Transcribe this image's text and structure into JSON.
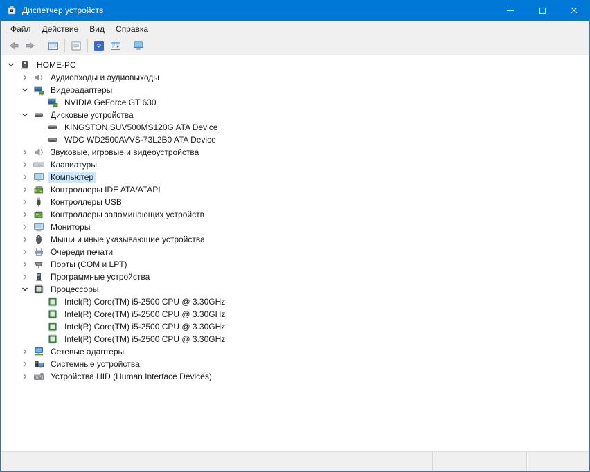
{
  "colors": {
    "accent": "#0078D7",
    "selection": "#CCE8FF",
    "window_border": "#4E6F8A"
  },
  "window": {
    "title": "Диспетчер устройств",
    "app_icon": "device-manager-icon",
    "controls": [
      {
        "name": "minimize",
        "icon": "minimize-icon"
      },
      {
        "name": "maximize",
        "icon": "maximize-icon"
      },
      {
        "name": "close",
        "icon": "close-icon"
      }
    ]
  },
  "menu": {
    "items": [
      {
        "label": "Файл",
        "hotkey": "Ф"
      },
      {
        "label": "Действие",
        "hotkey": "Д"
      },
      {
        "label": "Вид",
        "hotkey": "В"
      },
      {
        "label": "Справка",
        "hotkey": "С"
      }
    ]
  },
  "toolbar": {
    "items": [
      {
        "type": "button",
        "name": "back",
        "icon": "back-arrow-icon"
      },
      {
        "type": "button",
        "name": "forward",
        "icon": "forward-arrow-icon"
      },
      {
        "type": "separator"
      },
      {
        "type": "button",
        "name": "show-console-tree",
        "icon": "console-tree-icon"
      },
      {
        "type": "separator"
      },
      {
        "type": "button",
        "name": "properties",
        "icon": "properties-icon"
      },
      {
        "type": "separator"
      },
      {
        "type": "button",
        "name": "help",
        "icon": "help-icon"
      },
      {
        "type": "button",
        "name": "show-action-pane",
        "icon": "action-pane-icon"
      },
      {
        "type": "separator"
      },
      {
        "type": "button",
        "name": "scan-hardware-changes",
        "icon": "scan-hardware-icon"
      }
    ]
  },
  "tree": {
    "rows": [
      {
        "level": 0,
        "state": "expanded",
        "icon": "computer-icon",
        "label": "HOME-PC",
        "selected": false
      },
      {
        "level": 1,
        "state": "collapsed",
        "icon": "audio-device-icon",
        "label": "Аудиовходы и аудиовыходы",
        "selected": false
      },
      {
        "level": 1,
        "state": "expanded",
        "icon": "display-adapter-icon",
        "label": "Видеоадаптеры",
        "selected": false
      },
      {
        "level": 2,
        "state": "leaf",
        "icon": "display-adapter-icon",
        "label": "NVIDIA GeForce GT 630",
        "selected": false
      },
      {
        "level": 1,
        "state": "expanded",
        "icon": "disk-drive-icon",
        "label": "Дисковые устройства",
        "selected": false
      },
      {
        "level": 2,
        "state": "leaf",
        "icon": "disk-drive-icon",
        "label": "KINGSTON SUV500MS120G ATA Device",
        "selected": false
      },
      {
        "level": 2,
        "state": "leaf",
        "icon": "disk-drive-icon",
        "label": "WDC WD2500AVVS-73L2B0 ATA Device",
        "selected": false
      },
      {
        "level": 1,
        "state": "collapsed",
        "icon": "sound-device-icon",
        "label": "Звуковые, игровые и видеоустройства",
        "selected": false
      },
      {
        "level": 1,
        "state": "collapsed",
        "icon": "keyboard-icon",
        "label": "Клавиатуры",
        "selected": false
      },
      {
        "level": 1,
        "state": "collapsed",
        "icon": "monitor-icon",
        "label": "Компьютер",
        "selected": true
      },
      {
        "level": 1,
        "state": "collapsed",
        "icon": "ide-controller-icon",
        "label": "Контроллеры IDE ATA/ATAPI",
        "selected": false
      },
      {
        "level": 1,
        "state": "collapsed",
        "icon": "usb-controller-icon",
        "label": "Контроллеры USB",
        "selected": false
      },
      {
        "level": 1,
        "state": "collapsed",
        "icon": "storage-controller-icon",
        "label": "Контроллеры запоминающих устройств",
        "selected": false
      },
      {
        "level": 1,
        "state": "collapsed",
        "icon": "monitor-icon",
        "label": "Мониторы",
        "selected": false
      },
      {
        "level": 1,
        "state": "collapsed",
        "icon": "mouse-icon",
        "label": "Мыши и иные указывающие устройства",
        "selected": false
      },
      {
        "level": 1,
        "state": "collapsed",
        "icon": "printer-icon",
        "label": "Очереди печати",
        "selected": false
      },
      {
        "level": 1,
        "state": "collapsed",
        "icon": "port-icon",
        "label": "Порты (COM и LPT)",
        "selected": false
      },
      {
        "level": 1,
        "state": "collapsed",
        "icon": "software-device-icon",
        "label": "Программные устройства",
        "selected": false
      },
      {
        "level": 1,
        "state": "expanded",
        "icon": "processor-icon",
        "label": "Процессоры",
        "selected": false
      },
      {
        "level": 2,
        "state": "leaf",
        "icon": "processor-core-icon",
        "label": "Intel(R) Core(TM) i5-2500 CPU @ 3.30GHz",
        "selected": false
      },
      {
        "level": 2,
        "state": "leaf",
        "icon": "processor-core-icon",
        "label": "Intel(R) Core(TM) i5-2500 CPU @ 3.30GHz",
        "selected": false
      },
      {
        "level": 2,
        "state": "leaf",
        "icon": "processor-core-icon",
        "label": "Intel(R) Core(TM) i5-2500 CPU @ 3.30GHz",
        "selected": false
      },
      {
        "level": 2,
        "state": "leaf",
        "icon": "processor-core-icon",
        "label": "Intel(R) Core(TM) i5-2500 CPU @ 3.30GHz",
        "selected": false
      },
      {
        "level": 1,
        "state": "collapsed",
        "icon": "network-adapter-icon",
        "label": "Сетевые адаптеры",
        "selected": false
      },
      {
        "level": 1,
        "state": "collapsed",
        "icon": "system-device-icon",
        "label": "Системные устройства",
        "selected": false
      },
      {
        "level": 1,
        "state": "collapsed",
        "icon": "hid-device-icon",
        "label": "Устройства HID (Human Interface Devices)",
        "selected": false
      }
    ]
  },
  "statusbar": {
    "sections": [
      "",
      "",
      ""
    ]
  }
}
